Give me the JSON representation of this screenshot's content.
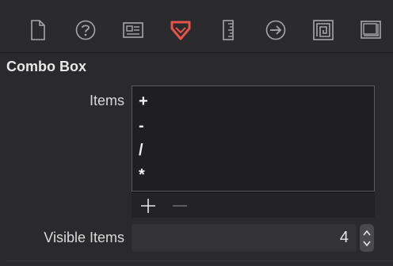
{
  "toolbar": {
    "icons": [
      {
        "name": "file-inspector-icon",
        "selected": false
      },
      {
        "name": "help-inspector-icon",
        "selected": false
      },
      {
        "name": "identity-inspector-icon",
        "selected": false
      },
      {
        "name": "attributes-inspector-icon",
        "selected": true
      },
      {
        "name": "size-inspector-icon",
        "selected": false
      },
      {
        "name": "connections-inspector-icon",
        "selected": false
      },
      {
        "name": "bindings-inspector-icon",
        "selected": false
      },
      {
        "name": "view-effects-inspector-icon",
        "selected": false
      }
    ],
    "selected_color": "#e5534b",
    "icon_color": "#a7a7a9"
  },
  "section": {
    "title": "Combo Box",
    "items_label": "Items",
    "items": [
      "+",
      "-",
      "/",
      "*"
    ],
    "visible_items_label": "Visible Items",
    "visible_items_value": "4"
  }
}
